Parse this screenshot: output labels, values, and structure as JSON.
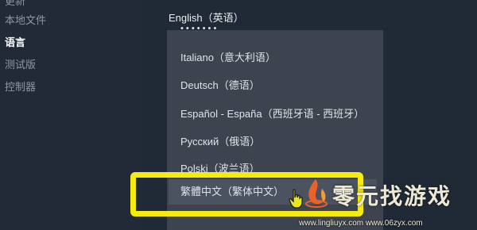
{
  "sidebar": {
    "items": [
      {
        "label": "更新",
        "active": false
      },
      {
        "label": "本地文件",
        "active": false
      },
      {
        "label": "语言",
        "active": true
      },
      {
        "label": "测试版",
        "active": false
      },
      {
        "label": "控制器",
        "active": false
      }
    ]
  },
  "language_select": {
    "current": "English（英语）",
    "options": [
      "Italiano（意大利语）",
      "Deutsch（德语）",
      "Español - España（西班牙语 - 西班牙）",
      "Русский（俄语）",
      "Polski（波兰语）",
      "繁體中文（繁体中文）"
    ],
    "highlighted": "繁體中文（繁体中文）"
  },
  "watermark": {
    "text": "零元找游戏",
    "url": "www.lingliuyx.com www.06zyx.com"
  },
  "colors": {
    "highlight_frame": "#f5eb13",
    "background": "#1b2838",
    "dropdown": "#3d4450"
  }
}
